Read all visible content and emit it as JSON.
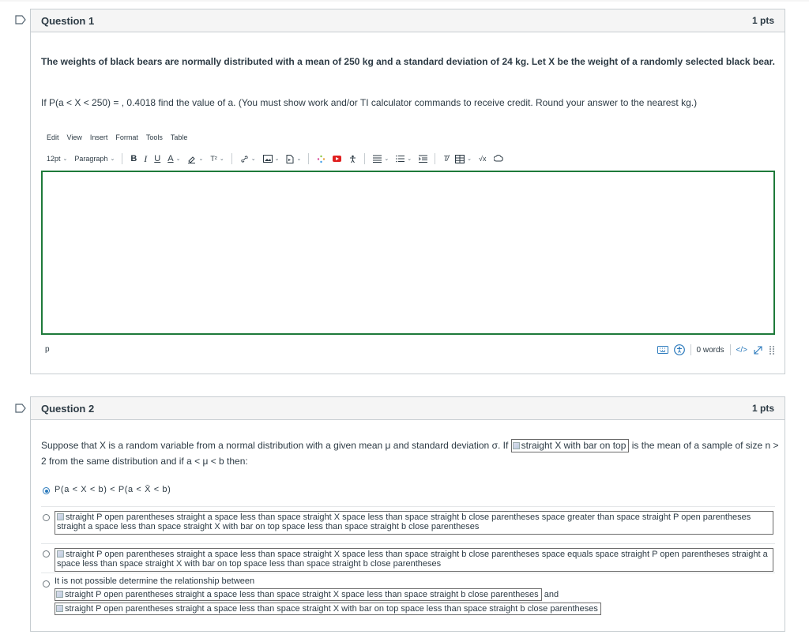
{
  "q1": {
    "title": "Question 1",
    "points": "1 pts",
    "bold_text": "The weights of black bears are normally distributed with a mean of 250 kg and a standard deviation of 24 kg. Let X be the weight of a randomly selected black bear.",
    "prompt": "If P(a < X < 250) = , 0.4018 find the value of a. (You must show work and/or TI calculator commands to receive credit. Round your answer to the nearest kg.)",
    "editor": {
      "menu": [
        "Edit",
        "View",
        "Insert",
        "Format",
        "Tools",
        "Table"
      ],
      "font_size": "12pt",
      "block_format": "Paragraph",
      "bold": "B",
      "italic": "I",
      "underline": "U",
      "text_color": "A",
      "superscript": "T²",
      "clear_format": "T̸",
      "equation": "√x",
      "path": "p",
      "word_count": "0 words",
      "html_toggle": "</>"
    }
  },
  "q2": {
    "title": "Question 2",
    "points": "1 pts",
    "text_before": "Suppose that X is a random variable from a normal distribution with a given mean μ and standard deviation σ. If ",
    "inline_img_alt": "straight X with bar on top",
    "text_after": " is the mean of a sample of size n > 2 from the same distribution and if a < μ < b then:",
    "answers": [
      {
        "label": "P(a < X < b) < P(a < X̄ < b)",
        "selected": true
      },
      {
        "label": "straight P open parentheses straight a space less than space straight X space less than space straight b close parentheses space greater than space straight P open parentheses straight a space less than space straight X with bar on top space less than space straight b close parentheses",
        "selected": false
      },
      {
        "label": "straight P open parentheses straight a space less than space straight X space less than space straight b close parentheses space equals space straight P open parentheses straight a space less than space straight X with bar on top space less than space straight b close parentheses",
        "selected": false
      },
      {
        "label": "It is not possible determine the relationship between",
        "img1": "straight P open parentheses straight a space less than space straight X space less than space straight b close parentheses",
        "and": "and",
        "img2": "straight P open parentheses straight a space less than space straight X with bar on top space less than space straight b close parentheses",
        "selected": false
      }
    ]
  },
  "colors": {
    "accent": "#2b7abc",
    "editor_border": "#1e7a3a",
    "header_bg": "#f5f5f5",
    "text": "#2d3b45"
  },
  "icons": [
    "flag-icon",
    "link-icon",
    "image-icon",
    "document-icon",
    "apps-icon",
    "media-icon",
    "accessibility-checker-icon",
    "align-icon",
    "list-icon",
    "indent-icon",
    "table-icon",
    "rce-icon",
    "keyboard-icon",
    "accessibility-icon",
    "fullscreen-icon",
    "drag-handle-icon"
  ]
}
